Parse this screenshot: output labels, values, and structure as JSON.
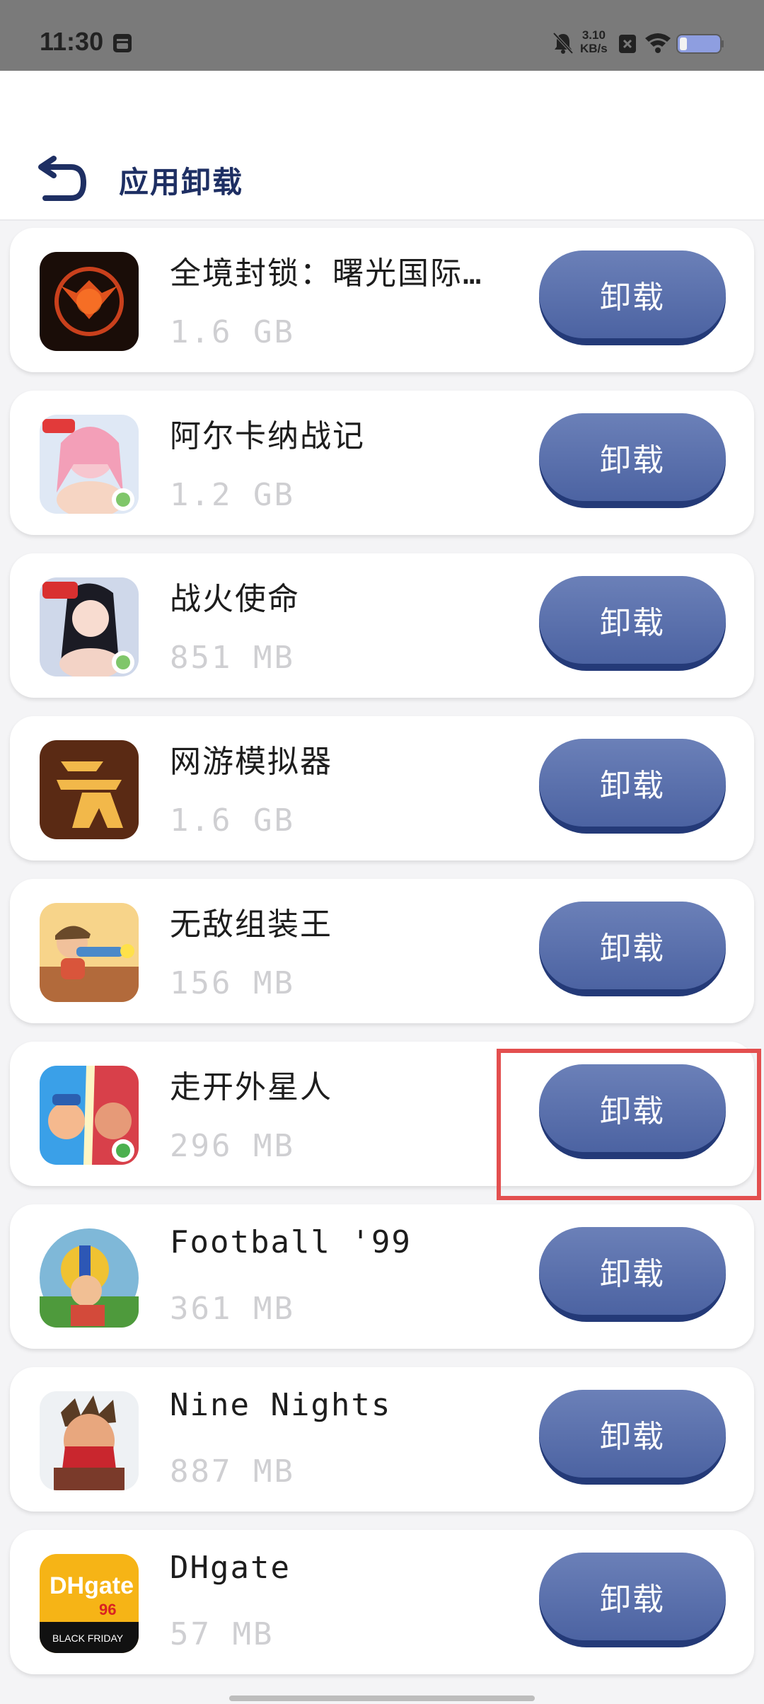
{
  "status_bar": {
    "time": "11:30",
    "net_speed_value": "3.10",
    "net_speed_unit": "KB/s",
    "icons": [
      "notification-icon",
      "mute-icon",
      "close-box-icon",
      "wifi-icon",
      "battery-icon"
    ]
  },
  "header": {
    "title": "应用卸载",
    "back_icon": "back-arrow-icon"
  },
  "apps": [
    {
      "name": "全境封锁：曙光国际…",
      "size": "1.6 GB",
      "button": "卸载",
      "icon": "game-icon"
    },
    {
      "name": "阿尔卡纳战记",
      "size": "1.2 GB",
      "button": "卸载",
      "icon": "game-icon"
    },
    {
      "name": "战火使命",
      "size": "851 MB",
      "button": "卸载",
      "icon": "game-icon"
    },
    {
      "name": "网游模拟器",
      "size": "1.6 GB",
      "button": "卸载",
      "icon": "game-icon"
    },
    {
      "name": "无敌组装王",
      "size": "156 MB",
      "button": "卸载",
      "icon": "game-icon"
    },
    {
      "name": "走开外星人",
      "size": "296 MB",
      "button": "卸载",
      "icon": "game-icon"
    },
    {
      "name": "Football '99",
      "size": "361 MB",
      "button": "卸载",
      "icon": "game-icon"
    },
    {
      "name": "Nine Nights",
      "size": "887 MB",
      "button": "卸载",
      "icon": "game-icon"
    },
    {
      "name": "DHgate",
      "size": "57 MB",
      "button": "卸载",
      "icon": "shopping-icon",
      "icon_text_main": "DHgate",
      "icon_text_sub": "BLACK FRIDAY",
      "icon_badge": "96"
    }
  ],
  "colors": {
    "title": "#1e2f63",
    "button_top": "#6b80b8",
    "button_shadow": "#243a78",
    "highlight": "#e34f4f",
    "size_text": "#cfcfd2"
  }
}
